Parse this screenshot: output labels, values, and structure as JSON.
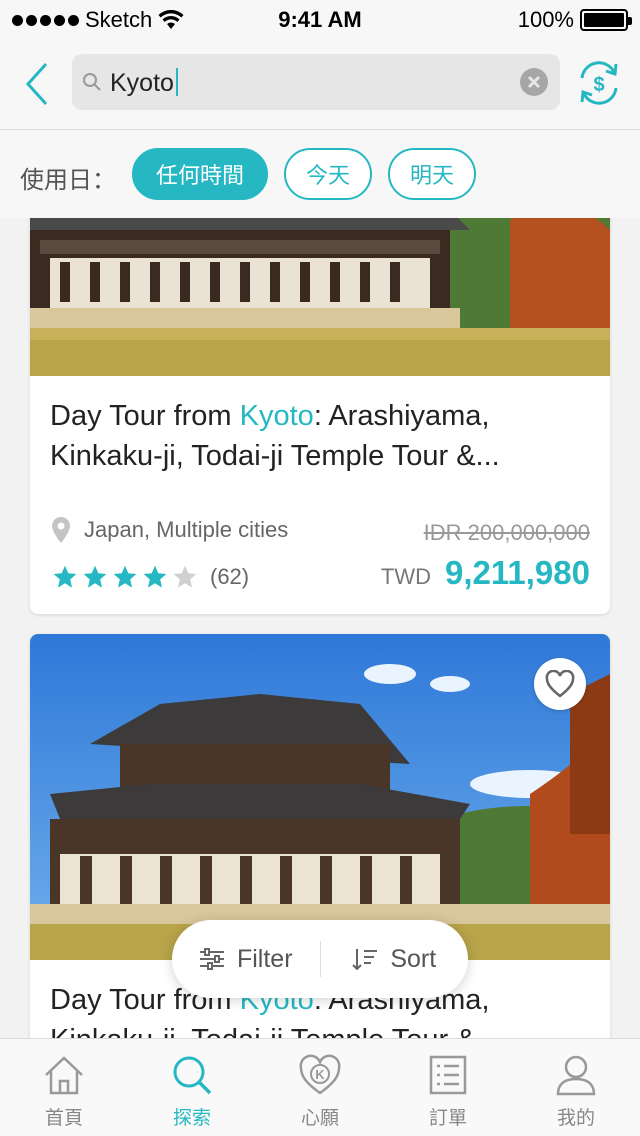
{
  "status_bar": {
    "carrier": "Sketch",
    "time": "9:41 AM",
    "battery": "100%"
  },
  "search": {
    "query": "Kyoto",
    "icons": {
      "back": "chevron-left-icon",
      "search": "search-icon",
      "clear": "clear-icon",
      "currency": "currency-exchange-icon"
    }
  },
  "date_filter": {
    "label": "使用日：",
    "options": [
      {
        "label": "任何時間",
        "selected": true
      },
      {
        "label": "今天",
        "selected": false
      },
      {
        "label": "明天",
        "selected": false
      }
    ]
  },
  "results": [
    {
      "title_prefix": "Day Tour from ",
      "title_highlight": "Kyoto",
      "title_suffix": ": Arashiyama, Kinkaku-ji, Todai-ji Temple Tour &...",
      "location": "Japan, Multiple cities",
      "rating_stars": 4,
      "review_count": "(62)",
      "original_price": "IDR 200,000,000",
      "currency": "TWD",
      "price": "9,211,980"
    },
    {
      "title_prefix": "Day Tour from ",
      "title_highlight": "Kyoto",
      "title_suffix": ": Arashiyama, Kinkaku-ji, Todai-ji Temple Tour &...",
      "wishlist_icon": "heart-icon"
    }
  ],
  "floating_actions": {
    "filter_label": "Filter",
    "sort_label": "Sort"
  },
  "tab_bar": [
    {
      "label": "首頁",
      "icon": "home-icon",
      "active": false
    },
    {
      "label": "探索",
      "icon": "search-icon",
      "active": true
    },
    {
      "label": "心願",
      "icon": "heart-k-icon",
      "active": false
    },
    {
      "label": "訂單",
      "icon": "list-icon",
      "active": false
    },
    {
      "label": "我的",
      "icon": "user-icon",
      "active": false
    }
  ],
  "colors": {
    "accent": "#25b8c3",
    "star_filled": "#25b8c3",
    "star_empty": "#d0d0d0"
  }
}
